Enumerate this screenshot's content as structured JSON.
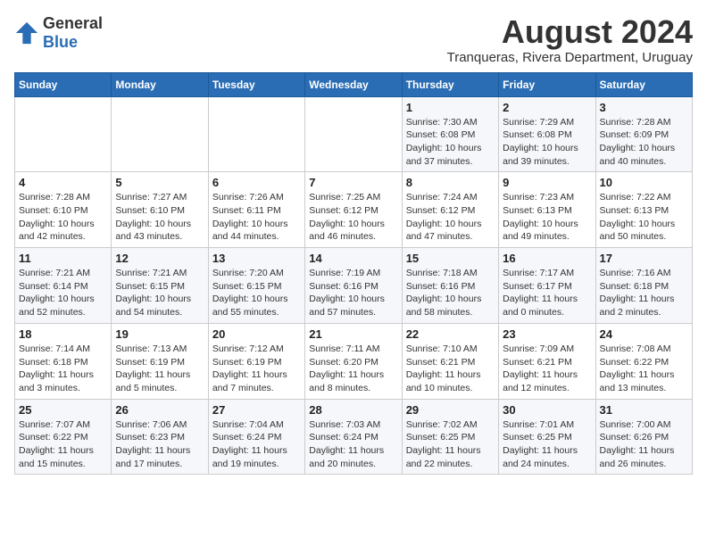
{
  "logo": {
    "general": "General",
    "blue": "Blue"
  },
  "title": "August 2024",
  "subtitle": "Tranqueras, Rivera Department, Uruguay",
  "days_header": [
    "Sunday",
    "Monday",
    "Tuesday",
    "Wednesday",
    "Thursday",
    "Friday",
    "Saturday"
  ],
  "weeks": [
    [
      {
        "day": "",
        "info": ""
      },
      {
        "day": "",
        "info": ""
      },
      {
        "day": "",
        "info": ""
      },
      {
        "day": "",
        "info": ""
      },
      {
        "day": "1",
        "info": "Sunrise: 7:30 AM\nSunset: 6:08 PM\nDaylight: 10 hours\nand 37 minutes."
      },
      {
        "day": "2",
        "info": "Sunrise: 7:29 AM\nSunset: 6:08 PM\nDaylight: 10 hours\nand 39 minutes."
      },
      {
        "day": "3",
        "info": "Sunrise: 7:28 AM\nSunset: 6:09 PM\nDaylight: 10 hours\nand 40 minutes."
      }
    ],
    [
      {
        "day": "4",
        "info": "Sunrise: 7:28 AM\nSunset: 6:10 PM\nDaylight: 10 hours\nand 42 minutes."
      },
      {
        "day": "5",
        "info": "Sunrise: 7:27 AM\nSunset: 6:10 PM\nDaylight: 10 hours\nand 43 minutes."
      },
      {
        "day": "6",
        "info": "Sunrise: 7:26 AM\nSunset: 6:11 PM\nDaylight: 10 hours\nand 44 minutes."
      },
      {
        "day": "7",
        "info": "Sunrise: 7:25 AM\nSunset: 6:12 PM\nDaylight: 10 hours\nand 46 minutes."
      },
      {
        "day": "8",
        "info": "Sunrise: 7:24 AM\nSunset: 6:12 PM\nDaylight: 10 hours\nand 47 minutes."
      },
      {
        "day": "9",
        "info": "Sunrise: 7:23 AM\nSunset: 6:13 PM\nDaylight: 10 hours\nand 49 minutes."
      },
      {
        "day": "10",
        "info": "Sunrise: 7:22 AM\nSunset: 6:13 PM\nDaylight: 10 hours\nand 50 minutes."
      }
    ],
    [
      {
        "day": "11",
        "info": "Sunrise: 7:21 AM\nSunset: 6:14 PM\nDaylight: 10 hours\nand 52 minutes."
      },
      {
        "day": "12",
        "info": "Sunrise: 7:21 AM\nSunset: 6:15 PM\nDaylight: 10 hours\nand 54 minutes."
      },
      {
        "day": "13",
        "info": "Sunrise: 7:20 AM\nSunset: 6:15 PM\nDaylight: 10 hours\nand 55 minutes."
      },
      {
        "day": "14",
        "info": "Sunrise: 7:19 AM\nSunset: 6:16 PM\nDaylight: 10 hours\nand 57 minutes."
      },
      {
        "day": "15",
        "info": "Sunrise: 7:18 AM\nSunset: 6:16 PM\nDaylight: 10 hours\nand 58 minutes."
      },
      {
        "day": "16",
        "info": "Sunrise: 7:17 AM\nSunset: 6:17 PM\nDaylight: 11 hours\nand 0 minutes."
      },
      {
        "day": "17",
        "info": "Sunrise: 7:16 AM\nSunset: 6:18 PM\nDaylight: 11 hours\nand 2 minutes."
      }
    ],
    [
      {
        "day": "18",
        "info": "Sunrise: 7:14 AM\nSunset: 6:18 PM\nDaylight: 11 hours\nand 3 minutes."
      },
      {
        "day": "19",
        "info": "Sunrise: 7:13 AM\nSunset: 6:19 PM\nDaylight: 11 hours\nand 5 minutes."
      },
      {
        "day": "20",
        "info": "Sunrise: 7:12 AM\nSunset: 6:19 PM\nDaylight: 11 hours\nand 7 minutes."
      },
      {
        "day": "21",
        "info": "Sunrise: 7:11 AM\nSunset: 6:20 PM\nDaylight: 11 hours\nand 8 minutes."
      },
      {
        "day": "22",
        "info": "Sunrise: 7:10 AM\nSunset: 6:21 PM\nDaylight: 11 hours\nand 10 minutes."
      },
      {
        "day": "23",
        "info": "Sunrise: 7:09 AM\nSunset: 6:21 PM\nDaylight: 11 hours\nand 12 minutes."
      },
      {
        "day": "24",
        "info": "Sunrise: 7:08 AM\nSunset: 6:22 PM\nDaylight: 11 hours\nand 13 minutes."
      }
    ],
    [
      {
        "day": "25",
        "info": "Sunrise: 7:07 AM\nSunset: 6:22 PM\nDaylight: 11 hours\nand 15 minutes."
      },
      {
        "day": "26",
        "info": "Sunrise: 7:06 AM\nSunset: 6:23 PM\nDaylight: 11 hours\nand 17 minutes."
      },
      {
        "day": "27",
        "info": "Sunrise: 7:04 AM\nSunset: 6:24 PM\nDaylight: 11 hours\nand 19 minutes."
      },
      {
        "day": "28",
        "info": "Sunrise: 7:03 AM\nSunset: 6:24 PM\nDaylight: 11 hours\nand 20 minutes."
      },
      {
        "day": "29",
        "info": "Sunrise: 7:02 AM\nSunset: 6:25 PM\nDaylight: 11 hours\nand 22 minutes."
      },
      {
        "day": "30",
        "info": "Sunrise: 7:01 AM\nSunset: 6:25 PM\nDaylight: 11 hours\nand 24 minutes."
      },
      {
        "day": "31",
        "info": "Sunrise: 7:00 AM\nSunset: 6:26 PM\nDaylight: 11 hours\nand 26 minutes."
      }
    ]
  ]
}
